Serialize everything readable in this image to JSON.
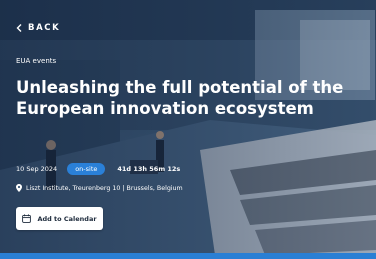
{
  "nav": {
    "back_label": "BACK"
  },
  "event": {
    "category": "EUA events",
    "title": "Unleashing the full potential of the European innovation ecosystem",
    "date": "10 Sep 2024",
    "format_badge": "on-site",
    "countdown": "41d 13h 56m 12s",
    "location": "Liszt Institute, Treurenberg 10 | Brussels, Belgium"
  },
  "actions": {
    "add_to_calendar_label": "Add to Calendar"
  },
  "icons": {
    "back": "chevron-left-icon",
    "location": "map-pin-icon",
    "calendar": "calendar-icon"
  },
  "colors": {
    "badge": "#2a80d8",
    "accent_strip": "#2a7fd4",
    "text": "#ffffff",
    "button_text": "#1e2b3c"
  }
}
